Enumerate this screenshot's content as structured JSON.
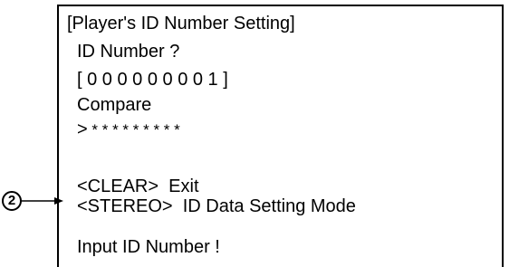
{
  "screen": {
    "title": "[Player's ID Number Setting]",
    "prompt": "ID Number ?",
    "id_value": "[ 0 0 0 0 0 0 0 0 1 ]",
    "compare_label": "Compare",
    "compare_marker": ">",
    "compare_value": " * * * * * * * * *",
    "clear_option": "<CLEAR>  Exit",
    "stereo_option": "<STEREO>  ID Data Setting Mode",
    "status_message": "Input ID Number !"
  },
  "callout": {
    "number": "2"
  }
}
